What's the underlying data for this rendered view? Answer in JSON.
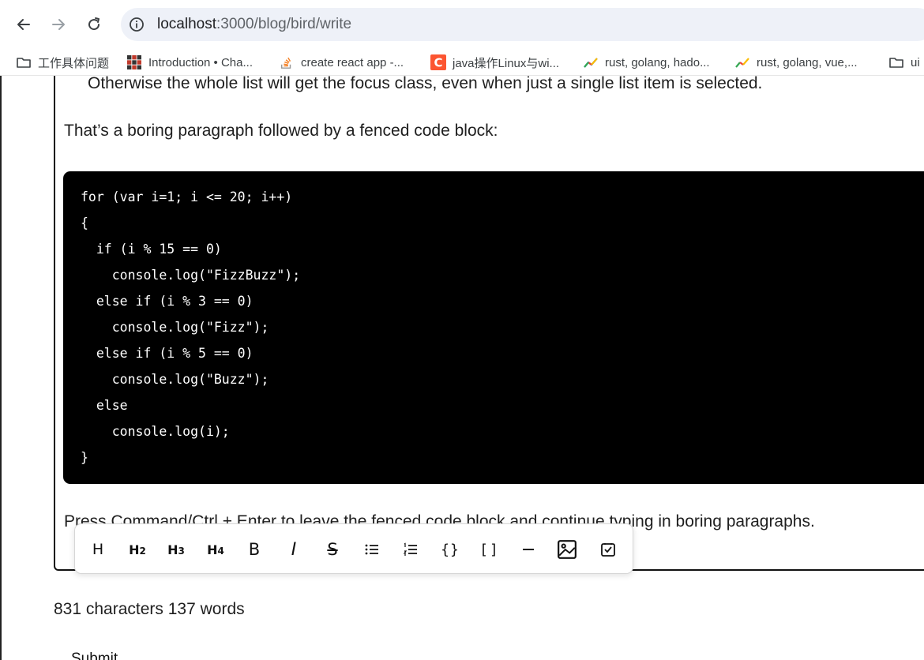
{
  "browser": {
    "url_host": "localhost",
    "url_path": ":3000/blog/bird/write",
    "bookmarks": [
      {
        "label": "工作具体问题",
        "icon": "folder-icon"
      },
      {
        "label": "Introduction • Cha...",
        "icon": "pixel-logo-icon"
      },
      {
        "label": "create react app -...",
        "icon": "stackoverflow-icon"
      },
      {
        "label": "java操作Linux与wi...",
        "icon": "csdn-icon"
      },
      {
        "label": "rust, golang, hado...",
        "icon": "trend-icon"
      },
      {
        "label": "rust, golang, vue,...",
        "icon": "trend-icon"
      },
      {
        "label": "ui",
        "icon": "folder-icon"
      }
    ]
  },
  "editor": {
    "cut_line": "Otherwise the whole list will get the focus class, even when just a single list item is selected.",
    "paragraph_before": "That’s a boring paragraph followed by a fenced code block:",
    "code_lines": [
      "for (var i=1; i <= 20; i++)",
      "{",
      "  if (i % 15 == 0)",
      "    console.log(\"FizzBuzz\");",
      "  else if (i % 3 == 0)",
      "    console.log(\"Fizz\");",
      "  else if (i % 5 == 0)",
      "    console.log(\"Buzz\");",
      "  else",
      "    console.log(i);",
      "}"
    ],
    "paragraph_after": "Press Command/Ctrl + Enter to leave the fenced code block and continue typing in boring paragraphs."
  },
  "toolbar": {
    "buttons": [
      {
        "name": "paragraph",
        "label": "H"
      },
      {
        "name": "heading-2",
        "label": "H",
        "sub": "2"
      },
      {
        "name": "heading-3",
        "label": "H",
        "sub": "3"
      },
      {
        "name": "heading-4",
        "label": "H",
        "sub": "4"
      },
      {
        "name": "bold",
        "label": "B"
      },
      {
        "name": "italic",
        "label": "I"
      },
      {
        "name": "strikethrough",
        "label": "S"
      },
      {
        "name": "bullet-list",
        "label": ""
      },
      {
        "name": "ordered-list",
        "label": ""
      },
      {
        "name": "code",
        "label": "{}"
      },
      {
        "name": "code-block",
        "label": "[]"
      },
      {
        "name": "horizontal-rule",
        "label": ""
      },
      {
        "name": "image",
        "label": ""
      },
      {
        "name": "task-list",
        "label": ""
      }
    ]
  },
  "stats": {
    "text": "831 characters 137 words"
  },
  "submit_label": "Submit"
}
